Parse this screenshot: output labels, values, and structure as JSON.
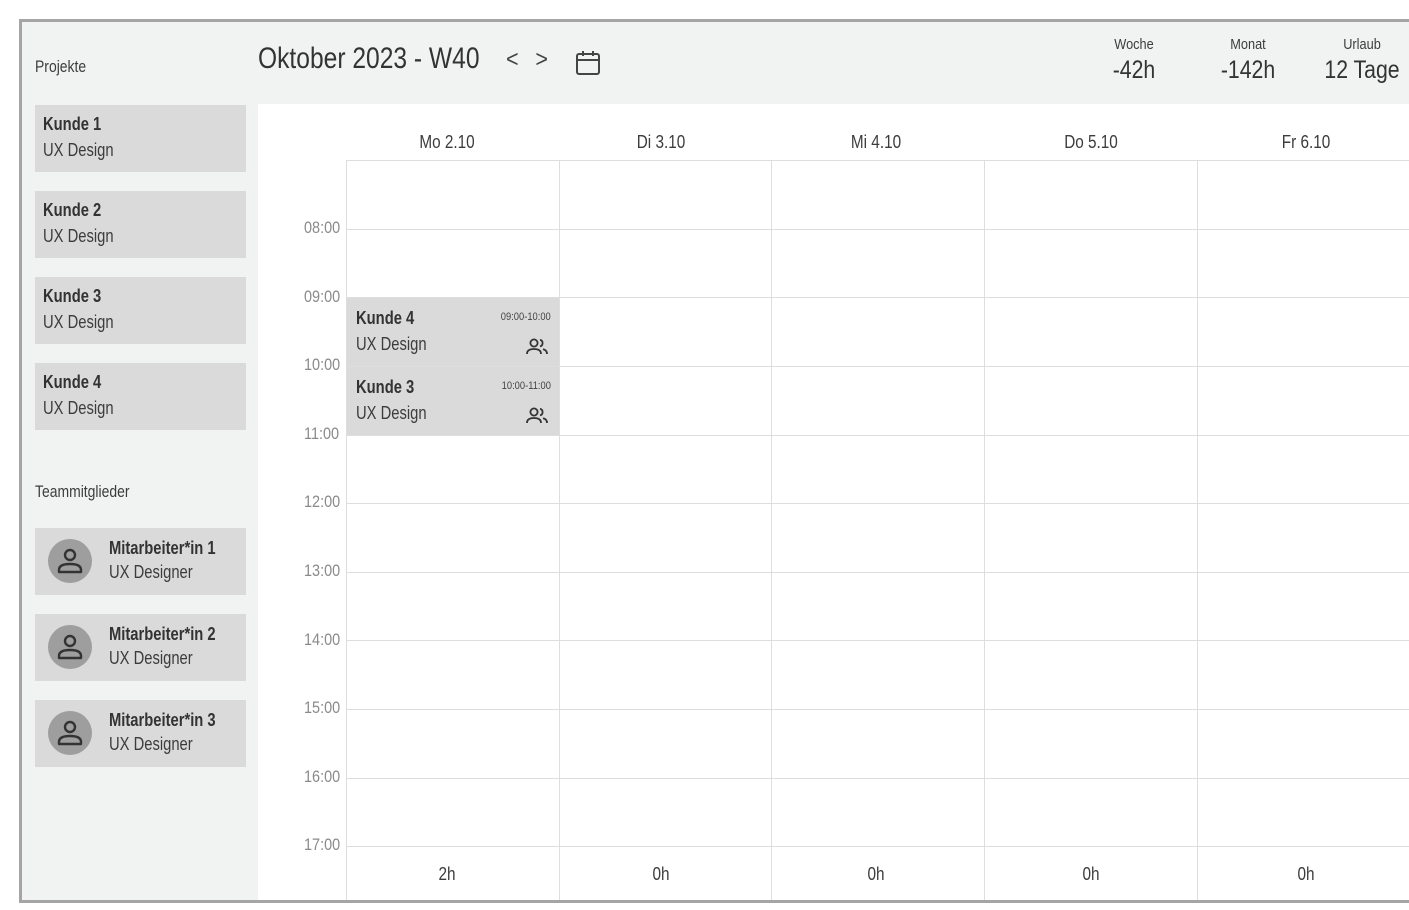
{
  "sidebar": {
    "projects_label": "Projekte",
    "projects": [
      {
        "client": "Kunde 1",
        "type": "UX Design"
      },
      {
        "client": "Kunde 2",
        "type": "UX Design"
      },
      {
        "client": "Kunde 3",
        "type": "UX Design"
      },
      {
        "client": "Kunde 4",
        "type": "UX Design"
      }
    ],
    "team_label": "Teammitglieder",
    "members": [
      {
        "name": "Mitarbeiter*in 1",
        "role": "UX Designer",
        "icon": "person-icon"
      },
      {
        "name": "Mitarbeiter*in 2",
        "role": "UX Designer",
        "icon": "person-icon"
      },
      {
        "name": "Mitarbeiter*in 3",
        "role": "UX Designer",
        "icon": "person-icon"
      }
    ]
  },
  "header": {
    "title": "Oktober 2023 -  W40",
    "nav_prev": "<",
    "nav_next": ">",
    "calendar_icon": "calendar-icon",
    "stats": [
      {
        "label": "Woche",
        "value": "-42h"
      },
      {
        "label": "Monat",
        "value": "-142h"
      },
      {
        "label": "Urlaub",
        "value": "12 Tage"
      }
    ]
  },
  "calendar": {
    "days": [
      "Mo 2.10",
      "Di 3.10",
      "Mi 4.10",
      "Do 5.10",
      "Fr 6.10"
    ],
    "hours": [
      "08:00",
      "09:00",
      "10:00",
      "11:00",
      "12:00",
      "13:00",
      "14:00",
      "15:00",
      "16:00",
      "17:00"
    ],
    "totals": [
      "2h",
      "0h",
      "0h",
      "0h",
      "0h"
    ],
    "events": [
      {
        "client": "Kunde 4",
        "type": "UX Design",
        "time": "09:00-10:00",
        "icon": "people-icon"
      },
      {
        "client": "Kunde 3",
        "type": "UX Design",
        "time": "10:00-11:00",
        "icon": "people-icon"
      }
    ]
  },
  "colors": {
    "frame_bg": "#f1f3f2",
    "card_bg": "#dadada",
    "avatar": "#9e9e9e",
    "grid_line": "#dedede",
    "border": "#a5a5a5"
  }
}
